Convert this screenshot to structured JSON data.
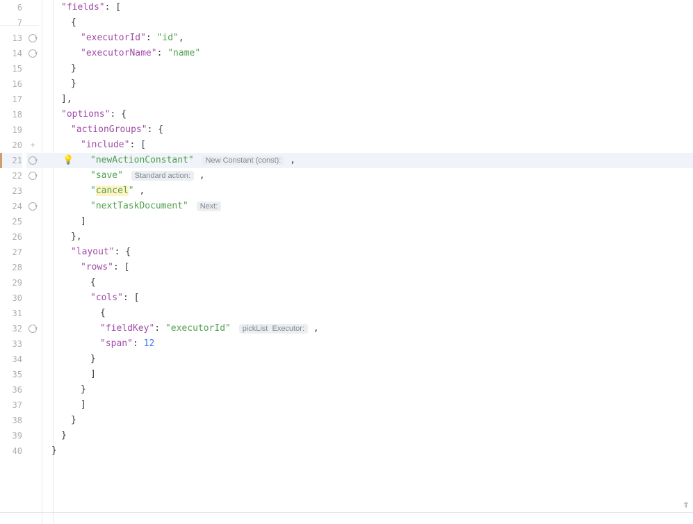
{
  "gutter": {
    "lines": [
      {
        "n": "6"
      },
      {
        "n": "7"
      },
      {
        "n": "13",
        "icon": "recurse"
      },
      {
        "n": "14",
        "icon": "recurse"
      },
      {
        "n": "15"
      },
      {
        "n": "16"
      },
      {
        "n": "17"
      },
      {
        "n": "18"
      },
      {
        "n": "19"
      },
      {
        "n": "20",
        "icon": "plus"
      },
      {
        "n": "21",
        "icon": "recurse",
        "active": true,
        "mark": true,
        "bulb": true
      },
      {
        "n": "22",
        "icon": "recurse"
      },
      {
        "n": "23"
      },
      {
        "n": "24",
        "icon": "recurse"
      },
      {
        "n": "25"
      },
      {
        "n": "26"
      },
      {
        "n": "27"
      },
      {
        "n": "28"
      },
      {
        "n": "29"
      },
      {
        "n": "30"
      },
      {
        "n": "31"
      },
      {
        "n": "32",
        "icon": "recurse"
      },
      {
        "n": "33"
      },
      {
        "n": "34"
      },
      {
        "n": "35"
      },
      {
        "n": "36"
      },
      {
        "n": "37"
      },
      {
        "n": "38"
      },
      {
        "n": "39"
      },
      {
        "n": "40"
      }
    ]
  },
  "code": {
    "l6": {
      "k": "fields",
      "p1": ": ["
    },
    "l7": {
      "p": "{"
    },
    "l13": {
      "k": "executorId",
      "v": "id"
    },
    "l14": {
      "k": "executorName",
      "v": "name"
    },
    "l15": {
      "p": "}"
    },
    "l16": {
      "p": "}"
    },
    "l17": {
      "p": "],"
    },
    "l18": {
      "k": "options",
      "p1": ": {"
    },
    "l19": {
      "k": "actionGroups",
      "p1": ": {"
    },
    "l20": {
      "k": "include",
      "p1": ": ["
    },
    "l21": {
      "v": "newActionConstant",
      "hint": "New Constant (const):",
      "tail": ","
    },
    "l22": {
      "v": "save",
      "hint": "Standard action:",
      "tail": ","
    },
    "l23": {
      "v": "cancel",
      "tail": ","
    },
    "l24": {
      "v": "nextTaskDocument",
      "hint": "Next:"
    },
    "l25": {
      "p": "]"
    },
    "l26": {
      "p": "},"
    },
    "l27": {
      "k": "layout",
      "p1": ": {"
    },
    "l28": {
      "k": "rows",
      "p1": ": ["
    },
    "l29": {
      "p": "{"
    },
    "l30": {
      "k": "cols",
      "p1": ": ["
    },
    "l31": {
      "p": "{"
    },
    "l32": {
      "k": "fieldKey",
      "v": "executorId",
      "hint": "pickList  Executor:",
      "tail": ","
    },
    "l33": {
      "k": "span",
      "n": "12"
    },
    "l34": {
      "p": "}"
    },
    "l35": {
      "p": "]"
    },
    "l36": {
      "p": "}"
    },
    "l37": {
      "p": "]"
    },
    "l38": {
      "p": "}"
    },
    "l39": {
      "p": "}"
    },
    "l40": {
      "p": "}"
    }
  },
  "indent": {
    "unit": 16,
    "base": 4
  }
}
